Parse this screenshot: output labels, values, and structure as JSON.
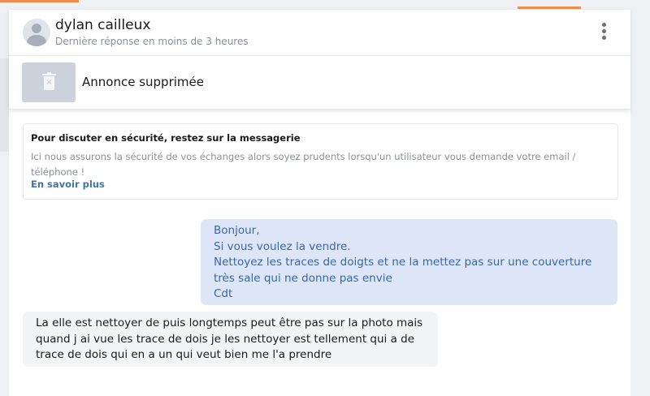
{
  "conversation": {
    "contact_name": "dylan cailleux",
    "response_time": "Dernière réponse en moins de 3 heures"
  },
  "listing": {
    "status_label": "Annonce supprimée"
  },
  "safety_notice": {
    "title": "Pour discuter en sécurité, restez sur la messagerie",
    "body": "Ici nous assurons la sécurité de vos échanges alors soyez prudents lorsqu'un utilisateur vous demande votre email / téléphone !",
    "link": "En savoir plus"
  },
  "messages": [
    {
      "direction": "sent",
      "text": "Bonjour,\nSi vous voulez la vendre.\nNettoyez les traces de doigts et ne la mettez pas sur une couverture très sale qui ne donne pas envie\nCdt"
    },
    {
      "direction": "received",
      "text": "La elle est nettoyer de puis longtemps peut être pas sur la photo mais quand j ai vue les trace de dois je les nettoyer est tellement qui a de trace de dois qui en a un qui veut bien me l'a prendre"
    }
  ],
  "colors": {
    "accent": "#ec8c4d",
    "sent_bubble": "#dce6f7",
    "sent_text": "#3c66a6",
    "received_bubble": "#f3f4f6",
    "link": "#3e74ab"
  },
  "icons": {
    "avatar": "user-avatar-icon",
    "menu": "more-vertical-icon",
    "deleted_ad": "trash-icon"
  }
}
